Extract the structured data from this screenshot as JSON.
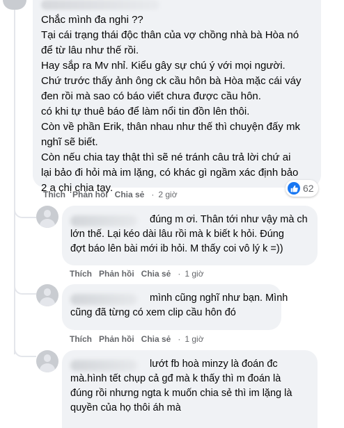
{
  "main_comment": {
    "lines": [
      "Chắc mình đa nghi ??",
      "Tại cái trạng thái độc thân của vợ chồng nhà bà Hòa nó",
      "để từ lâu như thế rồi.",
      "Hay sắp ra Mv nhỉ. Kiểu gây sự chú ý với mọi người.",
      "Chứ trước thấy ảnh ông ck cầu hôn bà Hòa mặc cái váy",
      "đen rồi mà sao có báo viết chưa được cầu hôn.",
      "có khi tự thuê báo để làm nổi tin đồn lên thôi.",
      "Còn về phần Erik, thân nhau như thế thì chuyện đấy mk",
      "nghĩ sẽ biết.",
      "Còn nếu chia tay thật thì sẽ né tránh câu trả lời chứ ai",
      "lại bảo đi hỏi mà im lặng, có khác gì ngầm xác định bảo",
      "2 a chị chia tay."
    ],
    "reaction_count": "62",
    "actions": {
      "like": "Thích",
      "reply": "Phản hồi",
      "share": "Chia sẻ",
      "separator": "·",
      "time": "2 giờ"
    }
  },
  "replies": [
    {
      "lines": [
        "đúng m ơi. Thân tới như vậy mà ch",
        "lớn thế. Lại kéo dài lâu rồi mà k biết k hỏi. Đúng",
        "đợt báo lên bài mới ib hỏi. M thấy coi vô lý k =))"
      ],
      "actions": {
        "like": "Thích",
        "reply": "Phản hồi",
        "share": "Chia sẻ",
        "separator": "·",
        "time": "1 giờ"
      }
    },
    {
      "lines": [
        "mình cũng nghĩ như bạn. Mình",
        "cũng đã từng có xem clip cầu hôn đó"
      ],
      "actions": {
        "like": "Thích",
        "reply": "Phản hồi",
        "share": "Chia sẻ",
        "separator": "·",
        "time": "1 giờ"
      }
    },
    {
      "lines": [
        "lướt fb hoà minzy là đoán đc",
        "mà.hình tết chụp cả gđ mà k thấy thì m đoán là",
        "đúng rồi nhưng ngta k muốn chia sẻ thì im lặng là",
        "quyền của họ thôi áh mà"
      ]
    }
  ]
}
